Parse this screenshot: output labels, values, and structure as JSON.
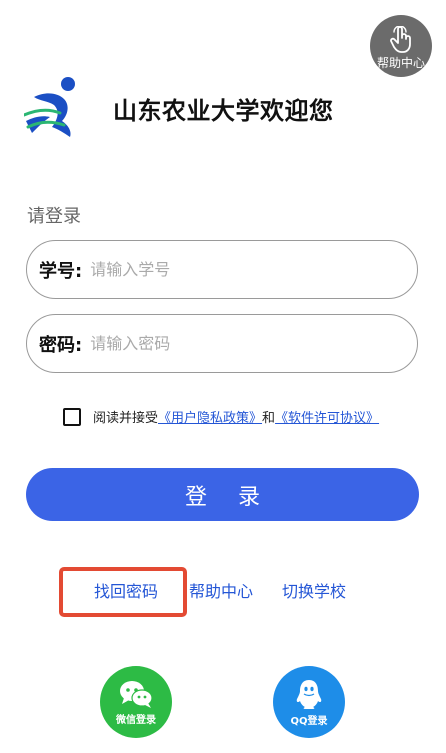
{
  "help_fab": {
    "label": "帮助中心",
    "icon": "hand-pointer-icon"
  },
  "header": {
    "logo": "runner-logo",
    "welcome": "山东农业大学欢迎您"
  },
  "login": {
    "heading": "请登录",
    "account_label": "学号:",
    "account_placeholder": "请输入学号",
    "password_label": "密码:",
    "password_placeholder": "请输入密码",
    "agreement_prefix": "阅读并接受",
    "privacy_link": "《用户隐私政策》",
    "agreement_and": "和",
    "license_link": "《软件许可协议》",
    "submit_label": "登 录"
  },
  "links": {
    "forgot_password": "找回密码",
    "help_center": "帮助中心",
    "switch_school": "切换学校"
  },
  "social": {
    "wechat_label": "微信登录",
    "qq_label": "QQ登录"
  },
  "colors": {
    "primary": "#3b64e6",
    "link": "#2456d6",
    "wechat": "#2dbb45",
    "qq": "#1e8de8",
    "highlight": "#e34a33"
  }
}
